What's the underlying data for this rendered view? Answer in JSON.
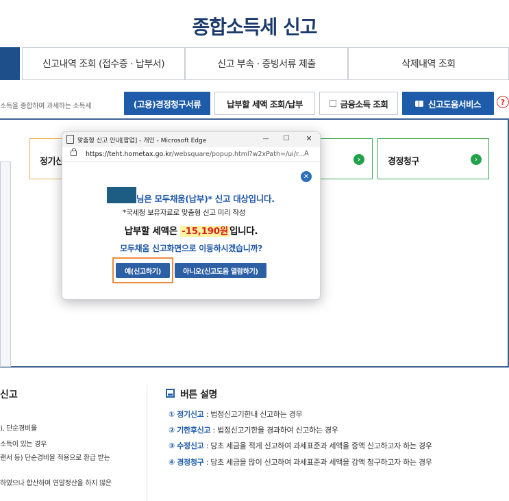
{
  "page": {
    "title": "종합소득세 신고"
  },
  "tabs": [
    {
      "label": ""
    },
    {
      "label": "신고내역 조회 (접수증 · 납부서)"
    },
    {
      "label": "신고 부속 · 증빙서류 제출"
    },
    {
      "label": "삭제내역 조회"
    }
  ],
  "description": "소득을 종합하여 과세하는 소득세",
  "buttons": {
    "employment": "(고용)경정청구서류",
    "tax_lookup": "납부할 세액 조회/납부",
    "finance_income": "금융소득 조회",
    "help_service": "신고도움서비스",
    "help_q": "?"
  },
  "cards": {
    "regular": "정기신",
    "correction": "경정청구",
    "go": "›"
  },
  "popup": {
    "window_title": "맞춤형 신고 안내[팝업] - 개인 - Microsoft Edge",
    "controls": {
      "min": "—",
      "max": "☐",
      "close": "✕"
    },
    "url_host": "https://teht.hometax.go.kr",
    "url_path": "/websquare/popup.html?w2xPath=/ui/r...",
    "read_aloud": "A",
    "close_symbol": "✕",
    "line1": "님은 모두채움(납부)* 신고 대상입니다.",
    "line2": "*국세청 보유자료로 맞춤형 신고 미리 작성",
    "line3_prefix": "납부할 세액은 ",
    "line3_amount": "-15,190원",
    "line3_suffix": "입니다.",
    "line4": "모두채움 신고화면으로 이동하시겠습니까?",
    "yes_button": "예(신고하기)",
    "no_button": "아니오(신고도움 열람하기)"
  },
  "left_section": {
    "title": "신고",
    "lines": [
      "), 단순경비율",
      "소득이 있는 경우",
      "랜서 등) 단순경비율 적용으로 환급 받는",
      "하였으나 합산하여 연말정산을 하지 않은"
    ]
  },
  "right_section": {
    "title": "버튼 설명",
    "items": [
      {
        "num": "①",
        "name": "정기신고",
        "desc": " : 법정신고기한내 신고하는 경우"
      },
      {
        "num": "②",
        "name": "기한후신고",
        "desc": " : 법정신고기한을 경과하여 신고하는 경우"
      },
      {
        "num": "③",
        "name": "수정신고",
        "desc": " : 당초 세금을 적게 신고하여 과세표준과 세액을 증액 신고하고자 하는 경우"
      },
      {
        "num": "④",
        "name": "경정청구",
        "desc": " : 당초 세금을 많이 신고하여 과세표준과 세액을 감액 청구하고자 하는 경우"
      }
    ]
  },
  "colors": {
    "navy": "#1b3a6b",
    "accent_blue": "#1e5ba8",
    "green": "#22a24a",
    "orange_highlight": "#e98a3d",
    "amount_red": "#d92020"
  }
}
